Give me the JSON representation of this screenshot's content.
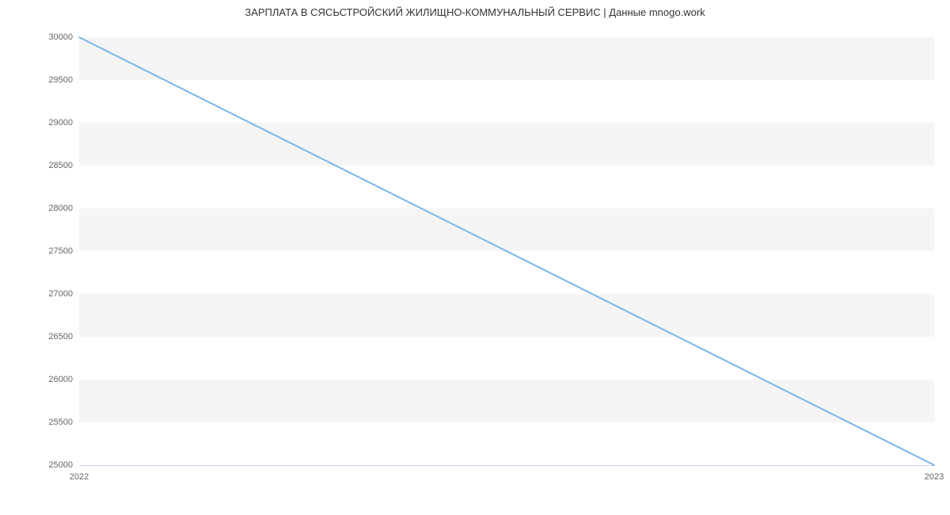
{
  "chart_data": {
    "type": "line",
    "title": "ЗАРПЛАТА В  СЯСЬСТРОЙСКИЙ ЖИЛИЩНО-КОММУНАЛЬНЫЙ СЕРВИС | Данные mnogo.work",
    "x": [
      2022,
      2023
    ],
    "values": [
      30000,
      25000
    ],
    "xlabel": "",
    "ylabel": "",
    "xlim": [
      2022,
      2023
    ],
    "ylim": [
      25000,
      30000
    ],
    "y_ticks": [
      25000,
      25500,
      26000,
      26500,
      27000,
      27500,
      28000,
      28500,
      29000,
      29500,
      30000
    ],
    "x_ticks": [
      2022,
      2023
    ],
    "line_color": "#7cb5ec",
    "band_color": "#f5f5f5"
  }
}
